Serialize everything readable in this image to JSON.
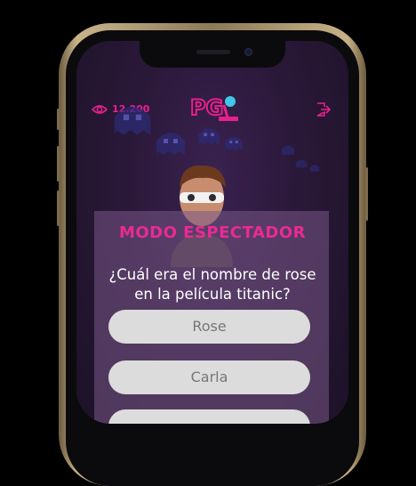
{
  "header": {
    "viewers_count": "12.200",
    "logo_text": "PG",
    "eye_icon": "eye-icon",
    "exit_icon": "exit-icon"
  },
  "quiz": {
    "mode_title": "MODO ESPECTADOR",
    "question_line1": "¿Cuál era el nombre de rose",
    "question_line2": "en la película titanic?",
    "answers": [
      "Rose",
      "Carla",
      ""
    ]
  },
  "colors": {
    "accent": "#e7208e",
    "background": "#2a1838",
    "answer_bg": "#dcdcdc"
  }
}
